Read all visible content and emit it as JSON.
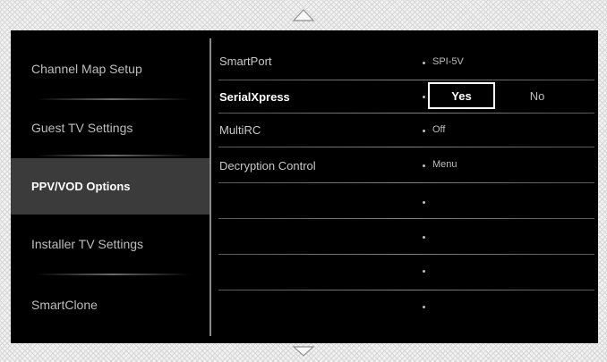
{
  "scroll": {
    "up_icon": "triangle-up-outline",
    "down_icon": "triangle-down-outline"
  },
  "sidebar": {
    "items": [
      {
        "label": "Channel Map Setup"
      },
      {
        "label": "Guest TV Settings"
      },
      {
        "label": "PPV/VOD Options",
        "selected": true
      },
      {
        "label": "Installer TV Settings"
      },
      {
        "label": "SmartClone"
      }
    ]
  },
  "settings": {
    "rows": [
      {
        "label": "SmartPort",
        "value": "SPI-5V"
      },
      {
        "label": "SerialXpress",
        "options": [
          "Yes",
          "No"
        ],
        "selected_option": "Yes",
        "focused": true
      },
      {
        "label": "MultiRC",
        "value": "Off"
      },
      {
        "label": "Decryption Control",
        "value": "Menu"
      },
      {
        "label": "",
        "value": ""
      },
      {
        "label": "",
        "value": ""
      },
      {
        "label": "",
        "value": ""
      },
      {
        "label": "",
        "value": ""
      }
    ]
  },
  "colors": {
    "panel_background": "#000000",
    "selected_item_background": "#3b3b3b",
    "text_primary": "#ffffff",
    "text_secondary": "#bdbdbd",
    "pattern_background": "#f2f2f2"
  }
}
